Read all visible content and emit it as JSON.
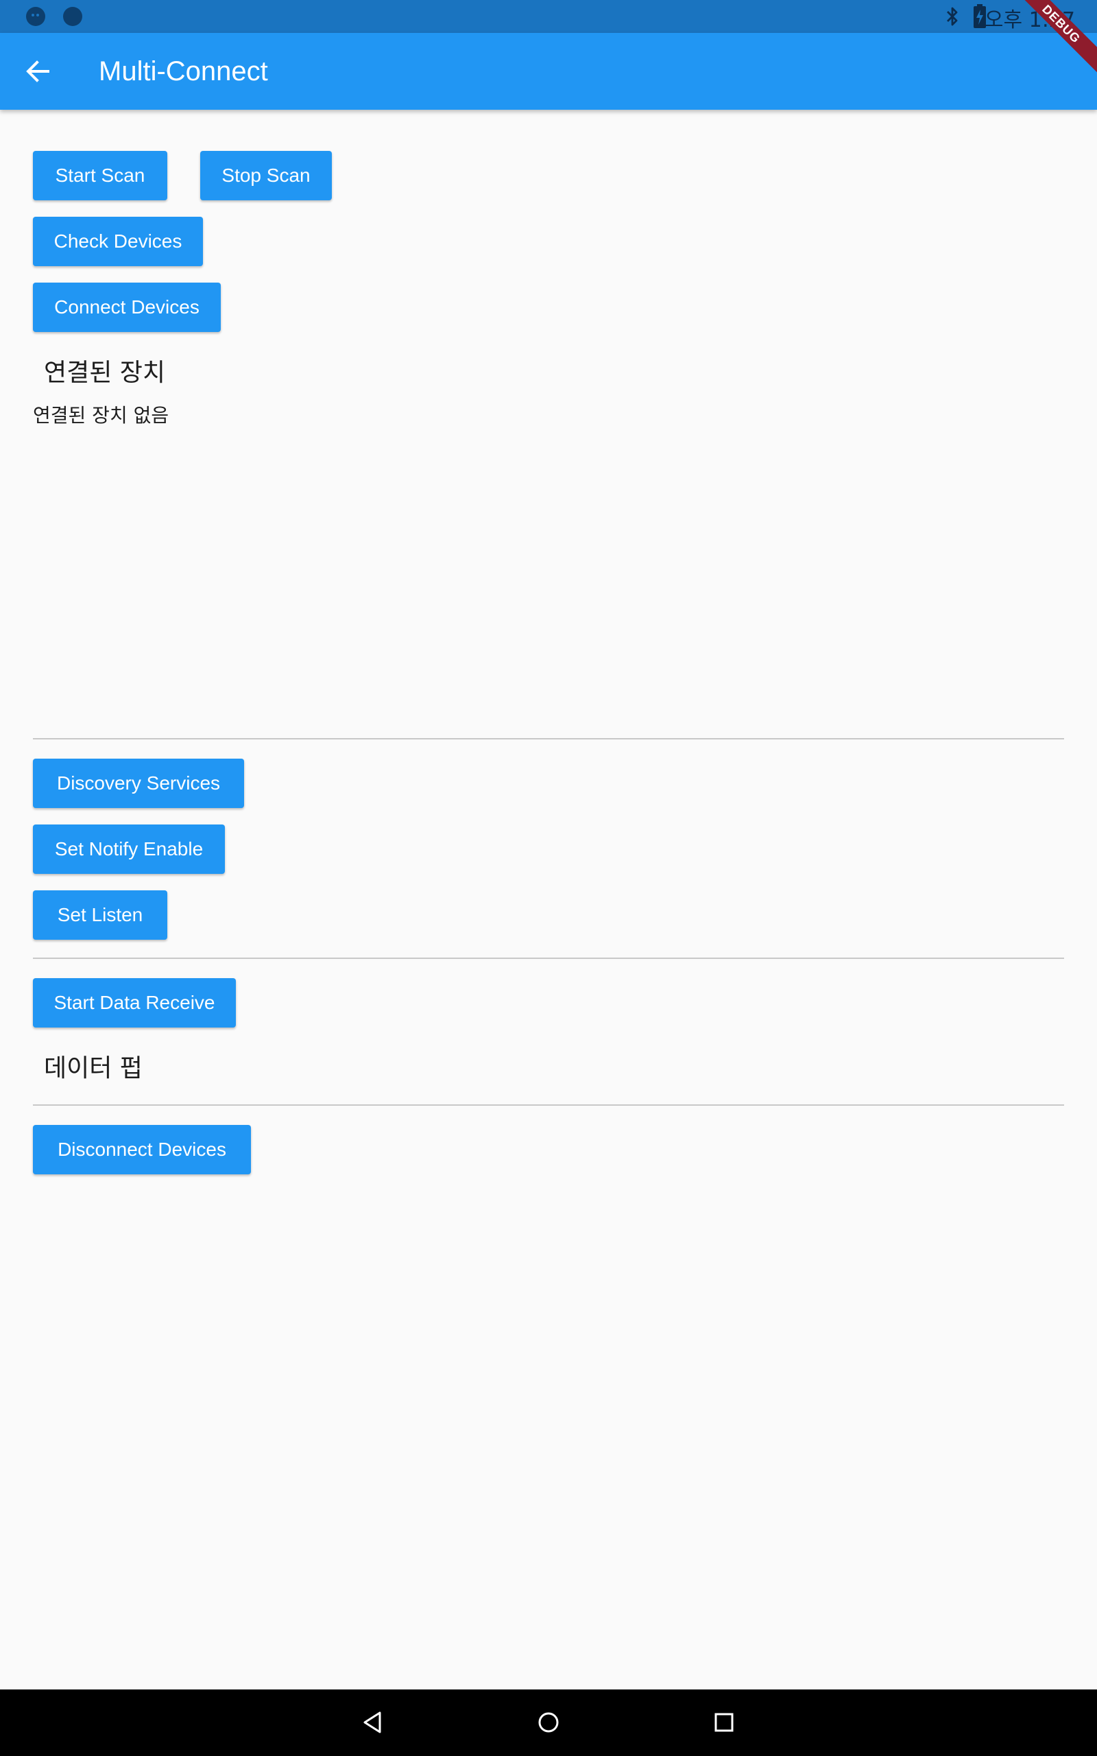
{
  "status_bar": {
    "time": "오후 1:27",
    "icons": [
      "chat-bubble-icon",
      "circle-notification-icon",
      "bluetooth-icon",
      "battery-charging-icon"
    ]
  },
  "debug_banner": "DEBUG",
  "app_bar": {
    "title": "Multi-Connect",
    "back_icon": "arrow-left-icon"
  },
  "scan": {
    "start_label": "Start Scan",
    "stop_label": "Stop Scan",
    "check_label": "Check Devices",
    "connect_label": "Connect Devices"
  },
  "connected": {
    "heading": "연결된 장치",
    "empty_text": "연결된 장치 없음"
  },
  "services": {
    "discovery_label": "Discovery Services",
    "notify_label": "Set Notify Enable",
    "listen_label": "Set Listen"
  },
  "data": {
    "receive_label": "Start Data Receive",
    "dump_heading": "데이터 펍"
  },
  "disconnect": {
    "label": "Disconnect Devices"
  },
  "nav_bar": {
    "icons": [
      "back-triangle-icon",
      "home-circle-icon",
      "recents-square-icon"
    ]
  },
  "colors": {
    "primary": "#2196f3",
    "status_bar": "#1a74c0",
    "background": "#fafafa",
    "debug_ribbon": "#8e1c2c"
  }
}
